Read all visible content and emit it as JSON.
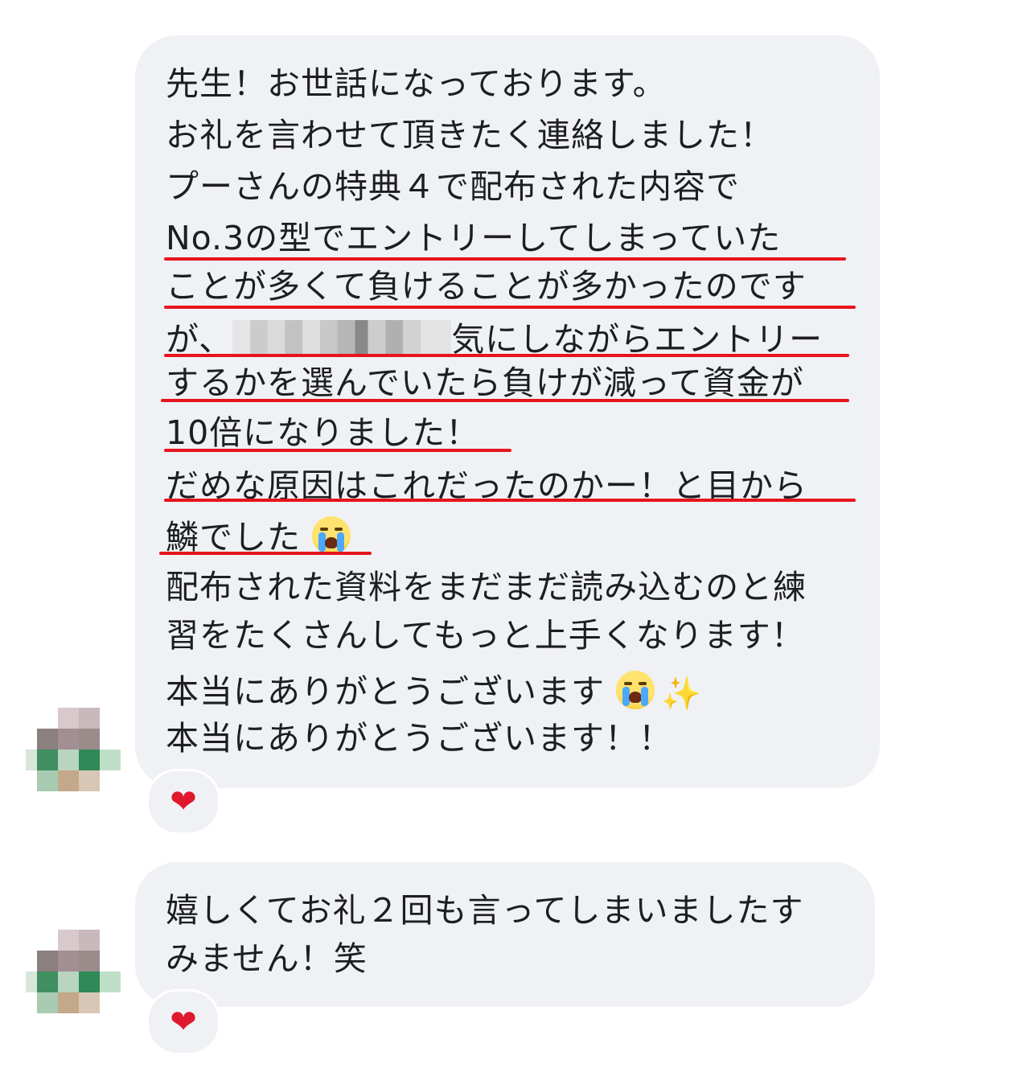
{
  "messages": [
    {
      "lines": [
        "先生！お世話になっております。",
        "お礼を言わせて頂きたく連絡しました！",
        "プーさんの特典４で配布された内容で",
        "No.3の型でエントリーしてしまっていた",
        "ことが多くて負けることが多かったのです",
        "が、",
        "気にしながらエントリー",
        "するかを選んでいたら負けが減って資金が",
        "10倍になりました！",
        "だめな原因はこれだったのかー！と目から",
        "鱗でした",
        "配布された資料をまだまだ読み込むのと練",
        "習をたくさんしてもっと上手くなります！",
        "本当にありがとうございます",
        "本当にありがとうございます！！"
      ],
      "reaction": "❤",
      "emoji": [
        "crying-face",
        "sparkles"
      ],
      "highlight_color": "#e8141c"
    },
    {
      "lines": [
        "嬉しくてお礼２回も言ってしまいましたす",
        "みません！笑"
      ],
      "reaction": "❤"
    }
  ],
  "colors": {
    "bubble": "#f0f1f4",
    "text": "#1c1e21",
    "underline": "#e8141c",
    "heart": "#e0182d"
  }
}
